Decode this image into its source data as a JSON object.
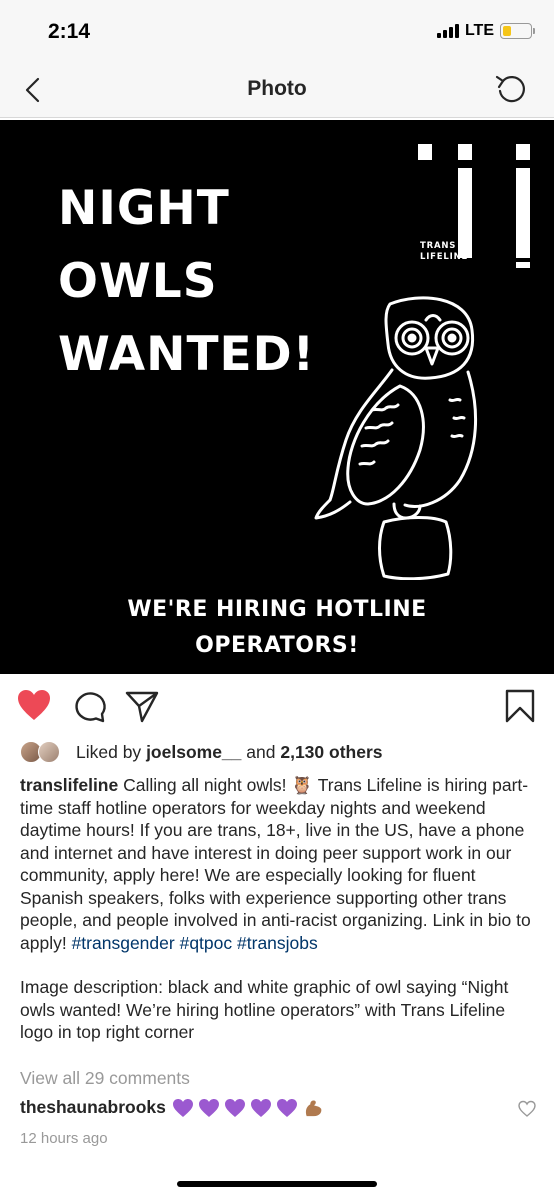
{
  "status_bar": {
    "time": "2:14",
    "network": "LTE",
    "battery_level": 0.3
  },
  "nav": {
    "title": "Photo"
  },
  "post_image": {
    "headline": [
      "NIGHT",
      "OWLS",
      "WANTED!"
    ],
    "logo_text": [
      "TRANS",
      "LIFELINE"
    ],
    "subline": [
      "WE'RE HIRING HOTLINE",
      "OPERATORS!"
    ]
  },
  "likes": {
    "prefix": "Liked by ",
    "user": "joelsome__",
    "middle": " and ",
    "count": "2,130 others"
  },
  "caption": {
    "user": "translifeline",
    "text": " Calling all night owls! 🦉 Trans Lifeline is hiring part-time staff hotline operators for weekday nights and weekend daytime hours! If you are trans, 18+, live in the US, have a phone and internet and have interest in doing peer support work in our community, apply here! We are especially looking for fluent Spanish speakers, folks with experience supporting other trans people, and people involved in anti-racist organizing. Link in bio to apply!",
    "hashtags": [
      "#transgender",
      "#qtpoc",
      "#transjobs"
    ],
    "description": "Image description: black and white graphic of owl saying “Night owls wanted! We’re hiring hotline operators” with Trans Lifeline logo in top right corner"
  },
  "view_comments": "View all 29 comments",
  "comment": {
    "user": "theshaunabrooks",
    "emoji": "💜💜💜💜💜💪🏽"
  },
  "timestamp": "12 hours ago",
  "colors": {
    "like_red": "#ed4956",
    "hashtag_blue": "#003569",
    "muted": "#999999",
    "purple_heart": "#9b59d0"
  }
}
